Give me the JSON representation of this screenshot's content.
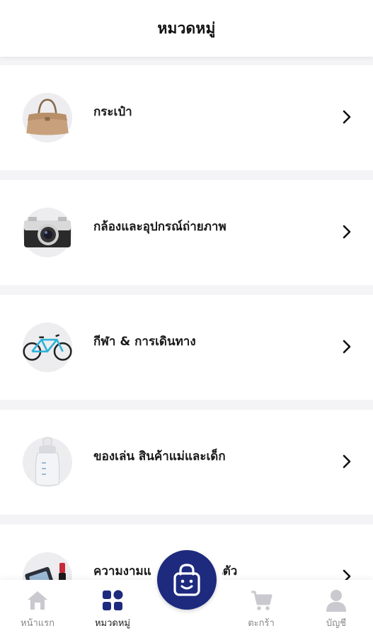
{
  "header": {
    "title": "หมวดหมู่"
  },
  "categories": [
    {
      "label": "กระเป๋า",
      "icon": "handbag-icon"
    },
    {
      "label": "กล้องและอุปกรณ์ถ่ายภาพ",
      "icon": "camera-icon"
    },
    {
      "label": "กีฬา & การเดินทาง",
      "icon": "bicycle-icon"
    },
    {
      "label": "ของเล่น สินค้าแม่และเด็ก",
      "icon": "baby-bottle-icon"
    },
    {
      "label": "ความงามและของใช้ส่วนตัว",
      "icon": "cosmetics-icon"
    }
  ],
  "bottom_nav": {
    "items": [
      {
        "label": "หน้าแรก",
        "icon": "home-icon",
        "active": false
      },
      {
        "label": "หมวดหมู่",
        "icon": "categories-grid-icon",
        "active": true
      },
      {
        "label": "ตะกร้า",
        "icon": "cart-icon",
        "active": false
      },
      {
        "label": "บัญชี",
        "icon": "account-icon",
        "active": false
      }
    ],
    "center_button": {
      "icon": "shopping-bag-smile-icon"
    }
  },
  "colors": {
    "brand": "#1e2a7e",
    "inactive_icon": "#c9c9cf",
    "background": "#f4f4f6"
  }
}
